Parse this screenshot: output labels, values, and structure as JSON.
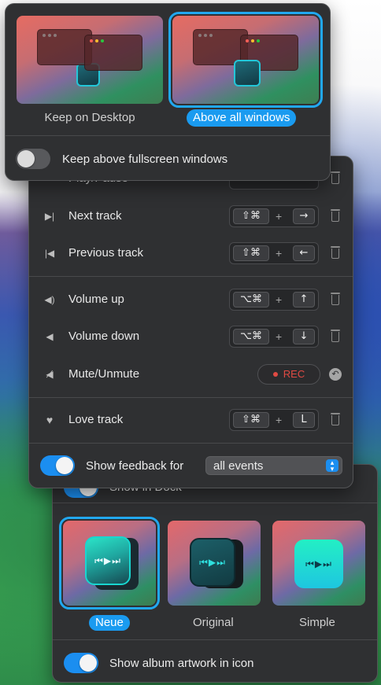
{
  "window_placement": {
    "options": [
      {
        "label": "Keep on Desktop",
        "selected": false
      },
      {
        "label": "Above all windows",
        "selected": true
      }
    ],
    "fullscreen_toggle": {
      "label": "Keep above fullscreen windows",
      "on": false
    }
  },
  "shortcuts": {
    "partial_row_label": "Play/Pause",
    "rows": [
      {
        "label": "Next track",
        "icon": "next-track-icon",
        "modifiers": "⇧⌘",
        "key": "→"
      },
      {
        "label": "Previous track",
        "icon": "previous-track-icon",
        "modifiers": "⇧⌘",
        "key": "←"
      },
      {
        "label": "Volume up",
        "icon": "volume-up-icon",
        "modifiers": "⌥⌘",
        "key": "↑"
      },
      {
        "label": "Volume down",
        "icon": "volume-down-icon",
        "modifiers": "⌥⌘",
        "key": "↓"
      },
      {
        "label": "Mute/Unmute",
        "icon": "mute-icon",
        "record_label": "REC"
      },
      {
        "label": "Love track",
        "icon": "heart-icon",
        "modifiers": "⇧⌘",
        "key": "L"
      }
    ],
    "plus": "+",
    "feedback": {
      "label": "Show feedback for",
      "on": true,
      "selected_option": "all events"
    }
  },
  "icon_style": {
    "partial_toggle_label": "Show in Dock",
    "options": [
      {
        "label": "Neue",
        "selected": true
      },
      {
        "label": "Original",
        "selected": false
      },
      {
        "label": "Simple",
        "selected": false
      }
    ],
    "artwork_toggle": {
      "label": "Show album artwork in icon",
      "on": true
    }
  },
  "colors": {
    "accent": "#1B8EF0",
    "selection_outline": "#21A8F0",
    "record": "#E04A43",
    "panel": "#2F3032"
  }
}
